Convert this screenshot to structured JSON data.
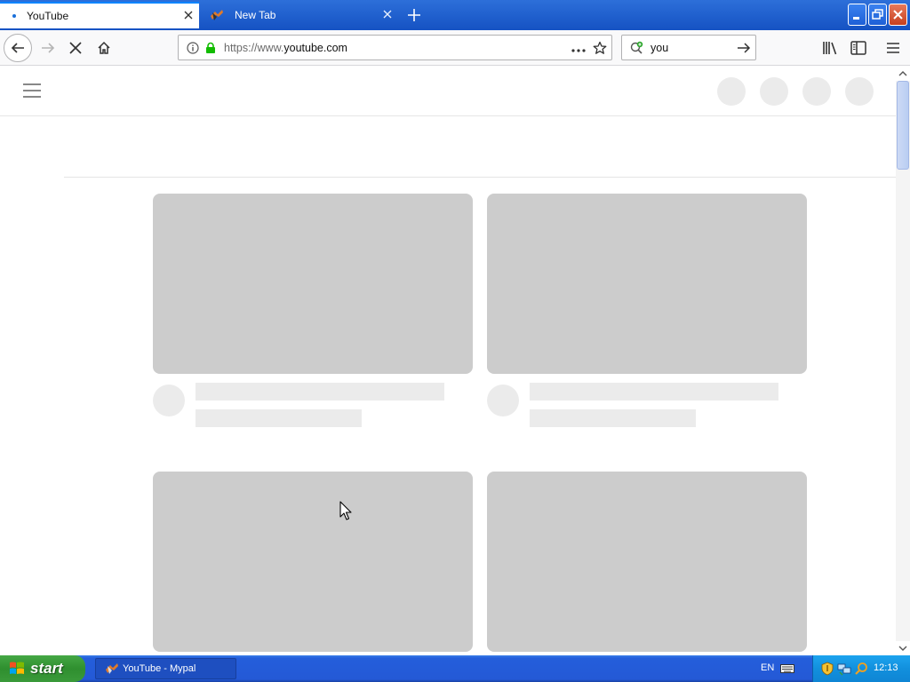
{
  "browser": {
    "tabs": [
      {
        "label": "YouTube",
        "active": true
      },
      {
        "label": "New Tab",
        "active": false
      }
    ],
    "url": {
      "prefix": "https://www.",
      "domain": "youtube.com"
    },
    "search": {
      "value": "you"
    }
  },
  "page": {
    "state": "loading-skeleton",
    "skeleton_thumb_color": "#cccccc",
    "skeleton_text_color": "#ebebeb"
  },
  "taskbar": {
    "start_label": "start",
    "task_label": "YouTube - Mypal",
    "language": "EN",
    "clock": "12:13"
  },
  "colors": {
    "titlebar": "#1552c3",
    "accent": "#0a84ff",
    "taskbar": "#245edb",
    "start_button": "#2f8f2f"
  },
  "icons": {
    "tabs": [
      "tab-loading-icon",
      "mypal-icon",
      "close-icon",
      "plus-icon"
    ],
    "nav": [
      "back-arrow-icon",
      "forward-arrow-icon",
      "stop-icon",
      "home-icon",
      "info-icon",
      "lock-icon",
      "more-icon",
      "star-icon",
      "search-icon",
      "go-arrow-icon",
      "library-icon",
      "sidebar-icon",
      "hamburger-menu-icon"
    ]
  }
}
